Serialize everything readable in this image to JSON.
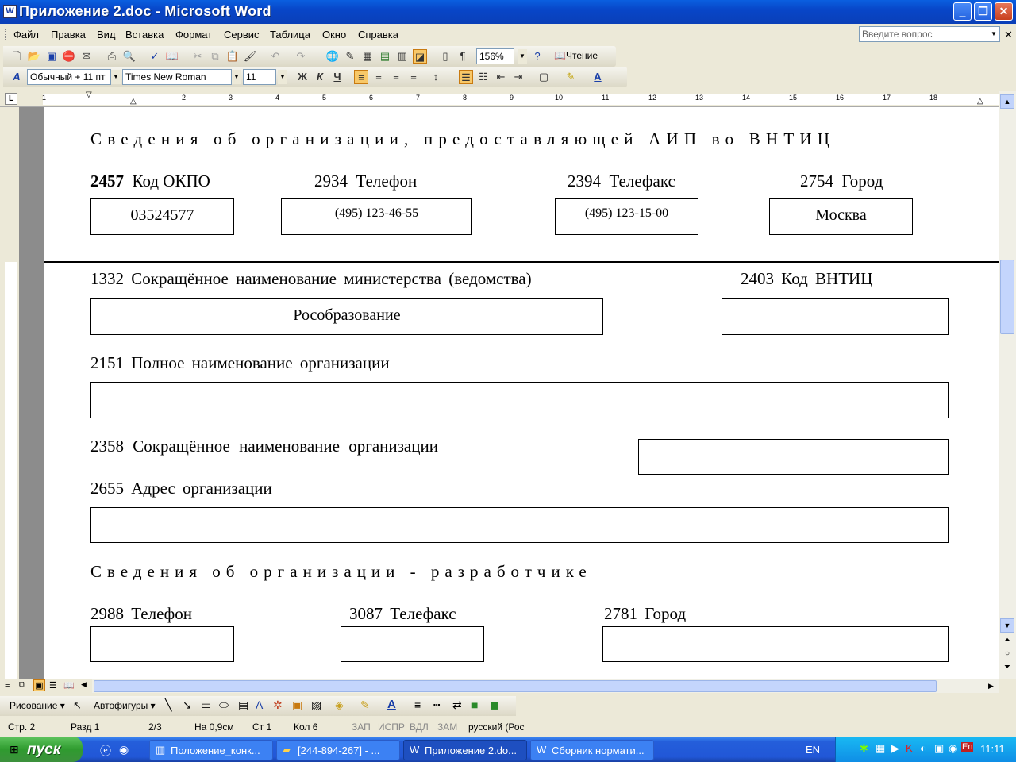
{
  "window": {
    "title": "Приложение 2.doc - Microsoft Word",
    "app_icon": "W"
  },
  "menu": {
    "items": [
      "Файл",
      "Правка",
      "Вид",
      "Вставка",
      "Формат",
      "Сервис",
      "Таблица",
      "Окно",
      "Справка"
    ],
    "help_placeholder": "Введите вопрос"
  },
  "standard_toolbar": {
    "zoom": "156%",
    "reading_label": "Чтение"
  },
  "format_toolbar": {
    "style": "Обычный + 11 пт",
    "font": "Times New Roman",
    "size": "11",
    "bold": "Ж",
    "italic": "К",
    "underline": "Ч"
  },
  "ruler": {
    "numbers": [
      "1",
      "2",
      "3",
      "4",
      "5",
      "6",
      "7",
      "8",
      "9",
      "10",
      "11",
      "12",
      "13",
      "14",
      "15",
      "16",
      "17",
      "18"
    ]
  },
  "document": {
    "section1_title": "Сведения об организации, предоставляющей АИП во ВНТИЦ",
    "okpo_code": "2457",
    "okpo_label": "Код ОКПО",
    "okpo_value": "03524577",
    "phone_code": "2934",
    "phone_label": "Телефон",
    "phone_value": "(495) 123-46-55",
    "fax_code": "2394",
    "fax_label": "Телефакс",
    "fax_value": "(495) 123-15-00",
    "city_code": "2754",
    "city_label": "Город",
    "city_value": "Москва",
    "ministry_label": "1332 Сокращённое наименование министерства (ведомства)",
    "ministry_value": "Рособразование",
    "vntic_label": "2403 Код ВНТИЦ",
    "fullname_label": "2151 Полное наименование организации",
    "shortname_label": "2358 Сокращённое наименование организации",
    "address_label": "2655 Адрес организации",
    "section2_title": "Сведения об организации - разработчике",
    "dev_phone_label": "2988 Телефон",
    "dev_fax_label": "3087 Телефакс",
    "dev_city_label": "2781 Город"
  },
  "drawing_toolbar": {
    "draw_label": "Рисование",
    "autoshapes_label": "Автофигуры"
  },
  "status": {
    "page": "Стр. 2",
    "section": "Разд 1",
    "pages": "2/3",
    "position": "На 0,9см",
    "line": "Ст 1",
    "col": "Кол 6",
    "rec": "ЗАП",
    "trk": "ИСПР",
    "ext": "ВДЛ",
    "ovr": "ЗАМ",
    "lang": "русский (Рос"
  },
  "taskbar": {
    "start": "пуск",
    "tasks": [
      "Положение_конк...",
      "[244-894-267] - ...",
      "Приложение 2.do...",
      "Сборник нормати..."
    ],
    "lang": "EN",
    "time": "11:11"
  }
}
